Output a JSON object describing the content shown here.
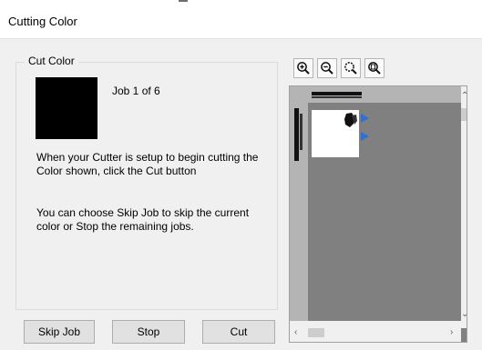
{
  "window": {
    "title": "Cutting Color"
  },
  "group": {
    "legend": "Cut Color"
  },
  "job": {
    "text": "Job 1 of 6"
  },
  "swatch": {
    "color": "#000000"
  },
  "info": {
    "line1": "When your Cutter is setup to begin cutting the Color shown, click the Cut button",
    "line2": "You can choose Skip Job to skip the current color or Stop the remaining jobs."
  },
  "buttons": {
    "skip": "Skip Job",
    "stop": "Stop",
    "cut": "Cut"
  },
  "toolbar": {
    "icons": [
      "zoom-in-icon",
      "zoom-out-icon",
      "zoom-fit-icon",
      "zoom-page-icon"
    ]
  },
  "preview": {
    "canvas_color": "#808080",
    "mat_color": "#ffffff",
    "marker_color": "#2f6fd6"
  }
}
